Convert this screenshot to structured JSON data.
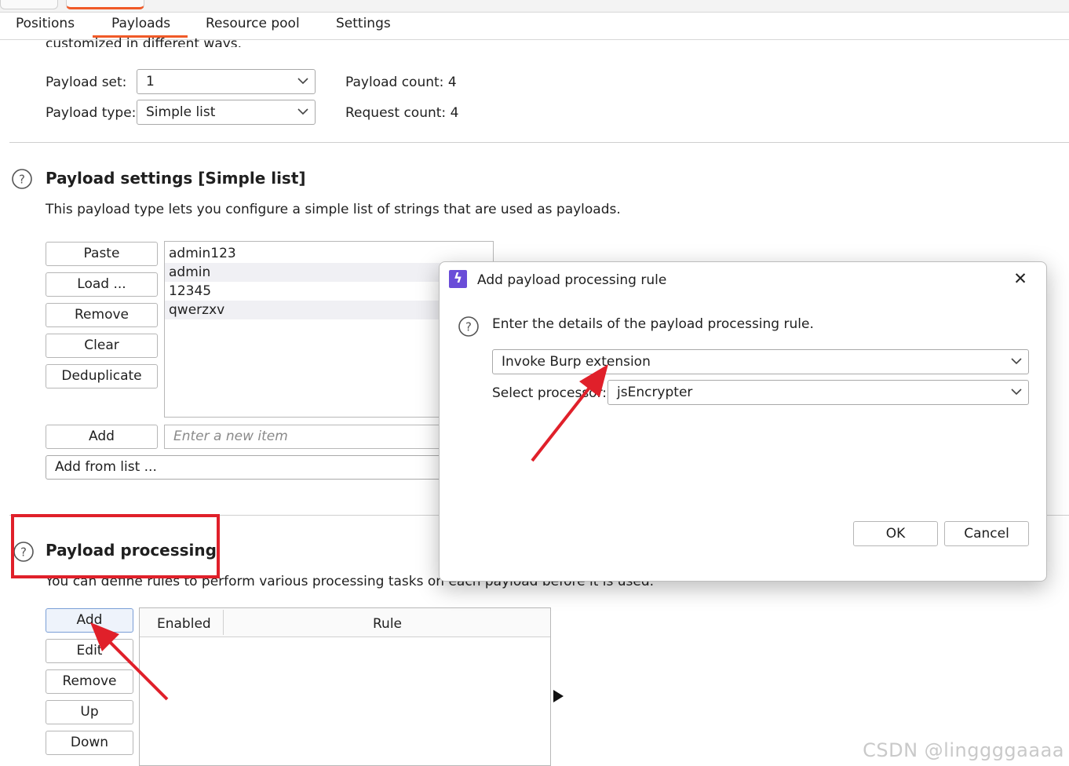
{
  "tabs": [
    "Positions",
    "Payloads",
    "Resource pool",
    "Settings"
  ],
  "active_tab": "Payloads",
  "intro_text": "customized in different ways.",
  "payload_set": {
    "label": "Payload set:",
    "value": "1"
  },
  "payload_type": {
    "label": "Payload type:",
    "value": "Simple list"
  },
  "payload_count": {
    "label": "Payload count:",
    "value": "4"
  },
  "request_count": {
    "label": "Request count:",
    "value": "4"
  },
  "payload_settings": {
    "title": "Payload settings [Simple list]",
    "description": "This payload type lets you configure a simple list of strings that are used as payloads.",
    "buttons": [
      "Paste",
      "Load ...",
      "Remove",
      "Clear",
      "Deduplicate"
    ],
    "items": [
      "admin123",
      "admin",
      "12345",
      "qwerzxv"
    ],
    "add_button": "Add",
    "new_item_placeholder": "Enter a new item",
    "add_from_list": "Add from list ..."
  },
  "payload_processing": {
    "title": "Payload processing",
    "description": "You can define rules to perform various processing tasks on each payload before it is used.",
    "buttons": [
      "Add",
      "Edit",
      "Remove",
      "Up",
      "Down"
    ],
    "columns": [
      "Enabled",
      "Rule"
    ]
  },
  "dialog": {
    "title": "Add payload processing rule",
    "prompt": "Enter the details of the payload processing rule.",
    "rule_type": "Invoke Burp extension",
    "processor_label": "Select processor:",
    "processor_value": "jsEncrypter",
    "ok": "OK",
    "cancel": "Cancel",
    "close_glyph": "✕",
    "icon_glyph": "ϟ"
  },
  "watermark": "CSDN @linggggaaaa",
  "colors": {
    "accent": "#f05a28",
    "annotation_red": "#e0202a",
    "dialog_icon": "#6a4dd8"
  }
}
